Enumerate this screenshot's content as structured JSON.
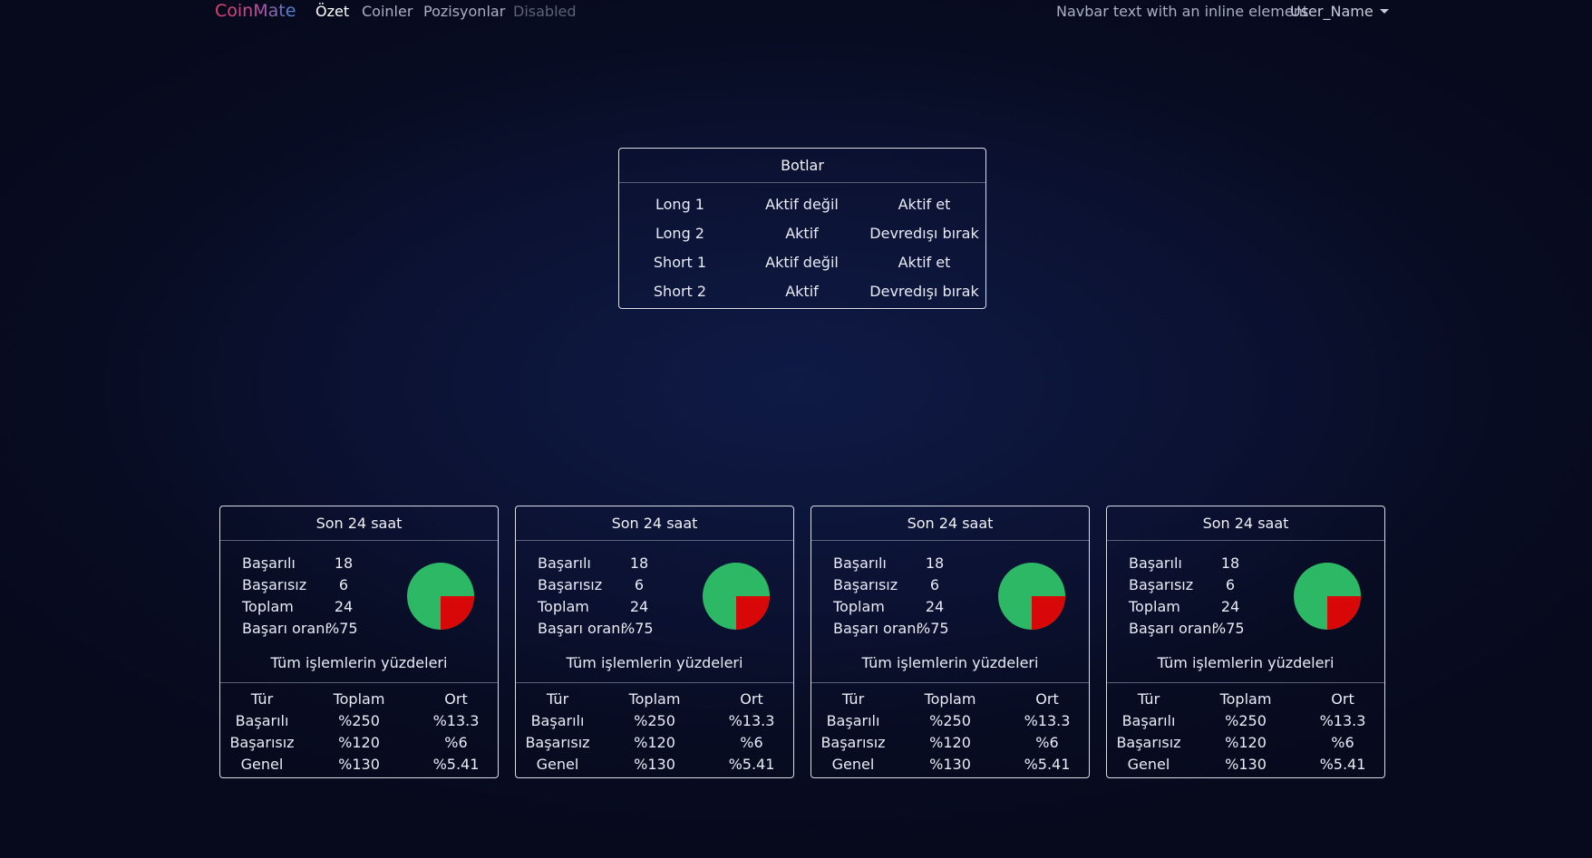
{
  "navbar": {
    "brand": "CoinMate",
    "links": [
      {
        "label": "Özet",
        "state": "active"
      },
      {
        "label": "Coinler",
        "state": "normal"
      },
      {
        "label": "Pozisyonlar",
        "state": "normal"
      },
      {
        "label": "Disabled",
        "state": "disabled"
      }
    ],
    "text": "Navbar text with an inline element",
    "user": "User_Name"
  },
  "bots": {
    "title": "Botlar",
    "rows": [
      {
        "name": "Long 1",
        "status": "Aktif değil",
        "action": "Aktif et"
      },
      {
        "name": "Long 2",
        "status": "Aktif",
        "action": "Devredışı bırak"
      },
      {
        "name": "Short 1",
        "status": "Aktif değil",
        "action": "Aktif et"
      },
      {
        "name": "Short 2",
        "status": "Aktif",
        "action": "Devredışı bırak"
      }
    ]
  },
  "colors": {
    "success": "#2db866",
    "fail": "#d90808"
  },
  "stats": [
    {
      "title": "Son 24 saat",
      "metrics": [
        {
          "label": "Başarılı",
          "value": "18"
        },
        {
          "label": "Başarısız",
          "value": "6"
        },
        {
          "label": "Toplam",
          "value": "24"
        },
        {
          "label": "Başarı oranı",
          "value": "%75"
        }
      ],
      "success_ratio": 0.75,
      "subtitle": "Tüm işlemlerin yüzdeleri",
      "table": {
        "headers": [
          "Tür",
          "Toplam",
          "Ort"
        ],
        "rows": [
          [
            "Başarılı",
            "%250",
            "%13.3"
          ],
          [
            "Başarısız",
            "%120",
            "%6"
          ],
          [
            "Genel",
            "%130",
            "%5.41"
          ]
        ]
      }
    },
    {
      "title": "Son 24 saat",
      "metrics": [
        {
          "label": "Başarılı",
          "value": "18"
        },
        {
          "label": "Başarısız",
          "value": "6"
        },
        {
          "label": "Toplam",
          "value": "24"
        },
        {
          "label": "Başarı oranı",
          "value": "%75"
        }
      ],
      "success_ratio": 0.75,
      "subtitle": "Tüm işlemlerin yüzdeleri",
      "table": {
        "headers": [
          "Tür",
          "Toplam",
          "Ort"
        ],
        "rows": [
          [
            "Başarılı",
            "%250",
            "%13.3"
          ],
          [
            "Başarısız",
            "%120",
            "%6"
          ],
          [
            "Genel",
            "%130",
            "%5.41"
          ]
        ]
      }
    },
    {
      "title": "Son 24 saat",
      "metrics": [
        {
          "label": "Başarılı",
          "value": "18"
        },
        {
          "label": "Başarısız",
          "value": "6"
        },
        {
          "label": "Toplam",
          "value": "24"
        },
        {
          "label": "Başarı oranı",
          "value": "%75"
        }
      ],
      "success_ratio": 0.75,
      "subtitle": "Tüm işlemlerin yüzdeleri",
      "table": {
        "headers": [
          "Tür",
          "Toplam",
          "Ort"
        ],
        "rows": [
          [
            "Başarılı",
            "%250",
            "%13.3"
          ],
          [
            "Başarısız",
            "%120",
            "%6"
          ],
          [
            "Genel",
            "%130",
            "%5.41"
          ]
        ]
      }
    },
    {
      "title": "Son 24 saat",
      "metrics": [
        {
          "label": "Başarılı",
          "value": "18"
        },
        {
          "label": "Başarısız",
          "value": "6"
        },
        {
          "label": "Toplam",
          "value": "24"
        },
        {
          "label": "Başarı oranı",
          "value": "%75"
        }
      ],
      "success_ratio": 0.75,
      "subtitle": "Tüm işlemlerin yüzdeleri",
      "table": {
        "headers": [
          "Tür",
          "Toplam",
          "Ort"
        ],
        "rows": [
          [
            "Başarılı",
            "%250",
            "%13.3"
          ],
          [
            "Başarısız",
            "%120",
            "%6"
          ],
          [
            "Genel",
            "%130",
            "%5.41"
          ]
        ]
      }
    }
  ]
}
